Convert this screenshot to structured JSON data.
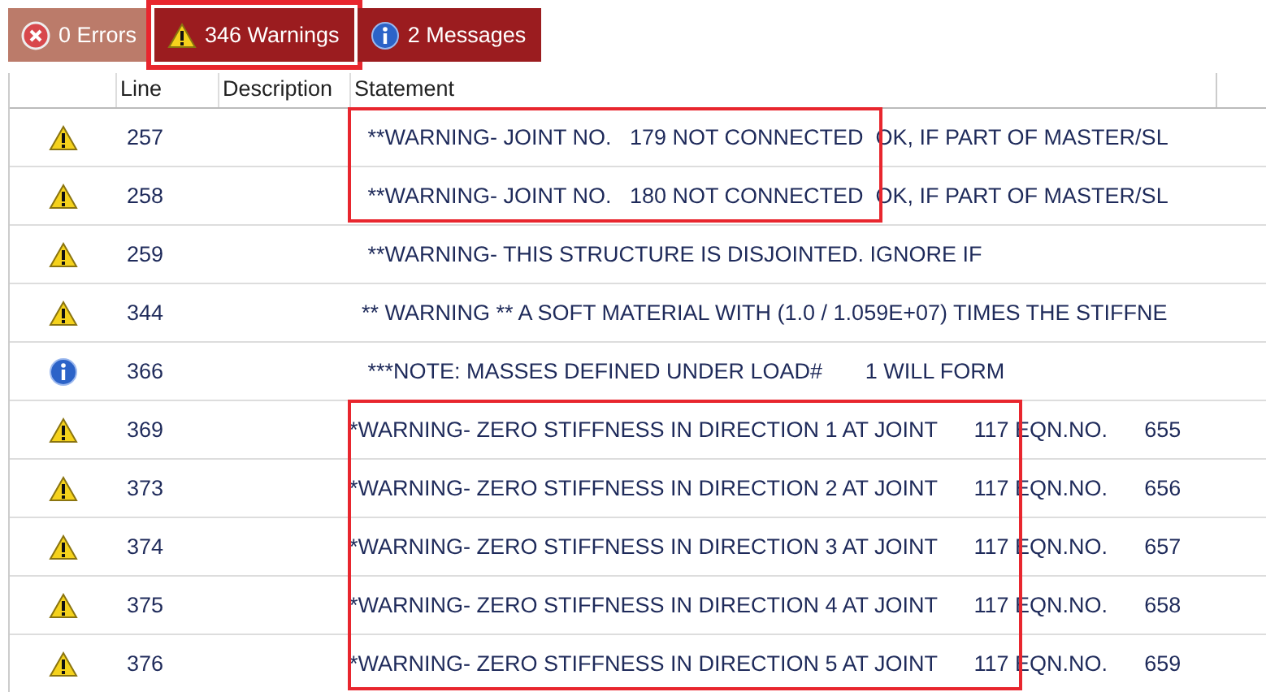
{
  "tabs": [
    {
      "label": "0 Errors",
      "kind": "error",
      "disabled": true,
      "highlighted": false
    },
    {
      "label": "346 Warnings",
      "kind": "warning",
      "disabled": false,
      "highlighted": true
    },
    {
      "label": "2 Messages",
      "kind": "info",
      "disabled": false,
      "highlighted": false
    }
  ],
  "table": {
    "columns": [
      "Line",
      "Description",
      "Statement"
    ],
    "rows": [
      {
        "kind": "warning",
        "line": "257",
        "statement": "   **WARNING- JOINT NO.   179 NOT CONNECTED  OK, IF PART OF MASTER/SL",
        "highlighted": true
      },
      {
        "kind": "warning",
        "line": "258",
        "statement": "   **WARNING- JOINT NO.   180 NOT CONNECTED  OK, IF PART OF MASTER/SL",
        "highlighted": true
      },
      {
        "kind": "warning",
        "line": "259",
        "statement": "   **WARNING- THIS STRUCTURE IS DISJOINTED. IGNORE IF",
        "highlighted": false
      },
      {
        "kind": "warning",
        "line": "344",
        "statement": "  ** WARNING ** A SOFT MATERIAL WITH (1.0 / 1.059E+07) TIMES THE STIFFNE",
        "highlighted": false
      },
      {
        "kind": "info",
        "line": "366",
        "statement": "   ***NOTE: MASSES DEFINED UNDER LOAD#       1 WILL FORM",
        "highlighted": false
      },
      {
        "kind": "warning",
        "line": "369",
        "statement": "*WARNING- ZERO STIFFNESS IN DIRECTION 1 AT JOINT      117 EQN.NO.      655",
        "highlighted": true
      },
      {
        "kind": "warning",
        "line": "373",
        "statement": "*WARNING- ZERO STIFFNESS IN DIRECTION 2 AT JOINT      117 EQN.NO.      656",
        "highlighted": true
      },
      {
        "kind": "warning",
        "line": "374",
        "statement": "*WARNING- ZERO STIFFNESS IN DIRECTION 3 AT JOINT      117 EQN.NO.      657",
        "highlighted": true
      },
      {
        "kind": "warning",
        "line": "375",
        "statement": "*WARNING- ZERO STIFFNESS IN DIRECTION 4 AT JOINT      117 EQN.NO.      658",
        "highlighted": true
      },
      {
        "kind": "warning",
        "line": "376",
        "statement": "*WARNING- ZERO STIFFNESS IN DIRECTION 5 AT JOINT      117 EQN.NO.      659",
        "highlighted": true
      }
    ]
  }
}
